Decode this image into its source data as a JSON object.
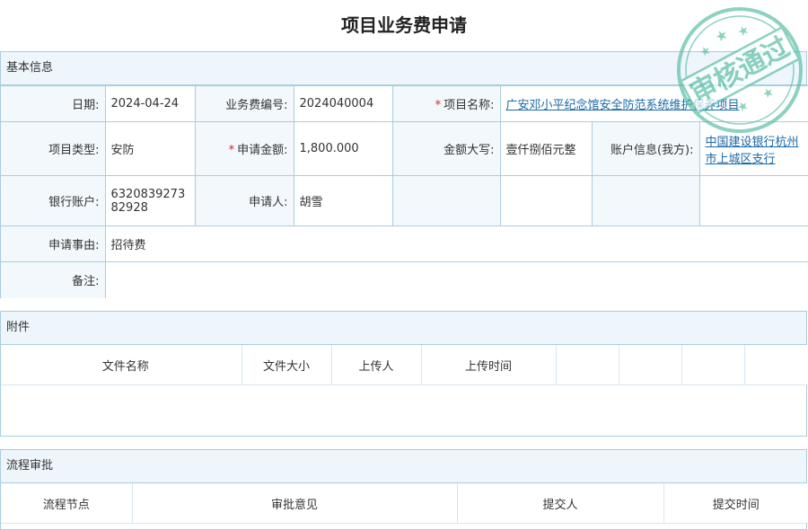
{
  "page": {
    "title": "项目业务费申请"
  },
  "basic": {
    "header": "基本信息",
    "date_label": "日期:",
    "date_value": "2024-04-24",
    "fee_no_label": "业务费编号:",
    "fee_no_value": "2024040004",
    "project_name_label": "项目名称:",
    "project_name_value": "广安邓小平纪念馆安全防范系统维护保养项目",
    "project_type_label": "项目类型:",
    "project_type_value": "安防",
    "amount_label": "申请金额:",
    "amount_value": "1,800.000",
    "amount_upper_label": "金额大写:",
    "amount_upper_value": "壹仟捌佰元整",
    "account_info_label": "账户信息(我方):",
    "account_info_value": "中国建设银行杭州市上城区支行",
    "bank_account_label": "银行账户:",
    "bank_account_value": "632083927382928",
    "applicant_label": "申请人:",
    "applicant_value": "胡雪",
    "reason_label": "申请事由:",
    "reason_value": "招待费",
    "remark_label": "备注:",
    "remark_value": ""
  },
  "attachments": {
    "header": "附件",
    "columns": [
      "文件名称",
      "文件大小",
      "上传人",
      "上传时间"
    ]
  },
  "workflow": {
    "header": "流程审批",
    "columns": [
      "流程节点",
      "审批意见",
      "提交人",
      "提交时间"
    ]
  },
  "stamp": {
    "text": "审核通过",
    "color": "#5cbfa6"
  }
}
